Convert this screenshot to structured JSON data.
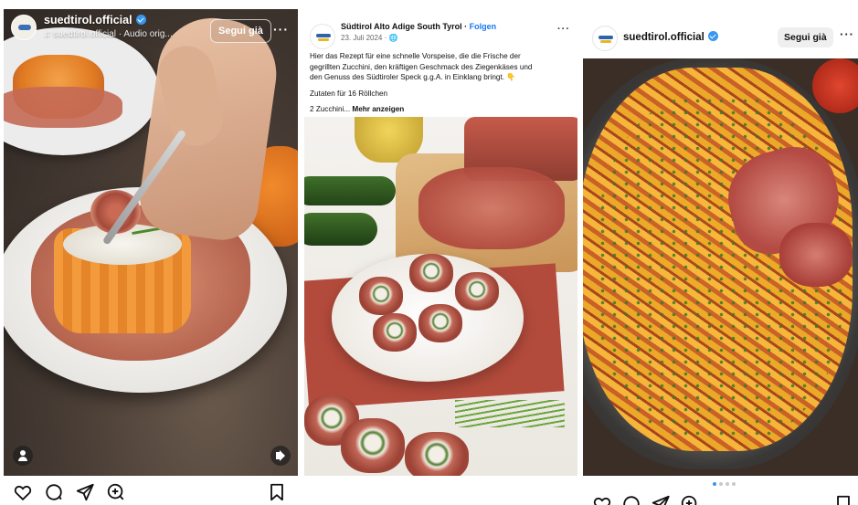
{
  "reel": {
    "username": "suedtirol.official",
    "audio_line": "suedtirol.official · Audio orig...",
    "follow_label": "Segui già",
    "more_label": "···"
  },
  "fb_post": {
    "page_name": "Südtirol Alto Adige South Tyrol",
    "separator": " · ",
    "follow_label": "Folgen",
    "date": "23. Juli 2024 · ",
    "more_label": "···",
    "body_lines": [
      "Hier das Rezept für eine schnelle Vorspeise, die die Frische der",
      "gegrillten Zucchini, den kräftigen Geschmack des Ziegenkäses und",
      "den Genuss des Südtiroler Speck g.g.A. in Einklang bringt. 👇"
    ],
    "ingredients_heading": "Zutaten für 16 Röllchen",
    "truncated_line": "2 Zucchini...",
    "see_more": " Mehr anzeigen"
  },
  "ig_post": {
    "username": "suedtirol.official",
    "follow_label": "Segui già",
    "more_label": "···"
  },
  "icons": [
    "heart-icon",
    "comment-icon",
    "share-icon",
    "remix-icon",
    "bookmark-icon"
  ]
}
